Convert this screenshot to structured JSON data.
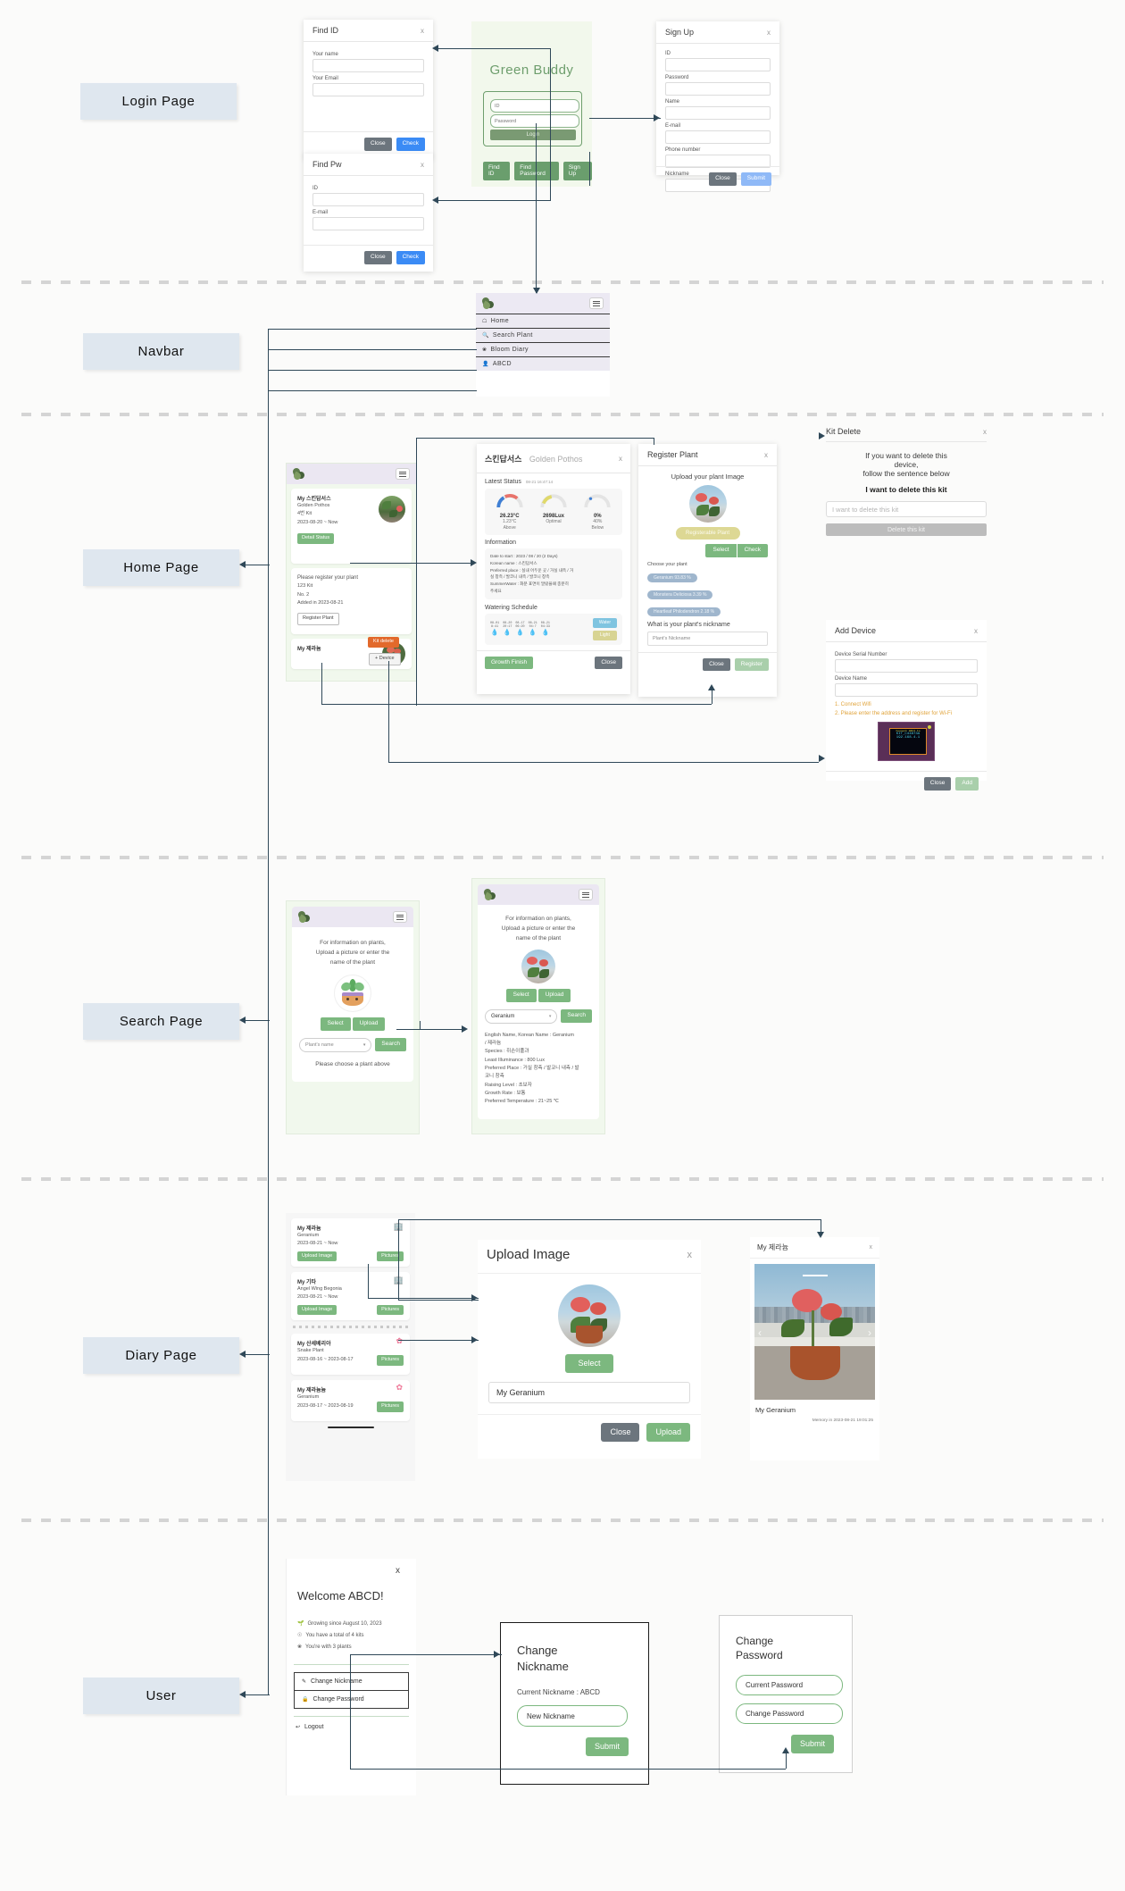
{
  "sections": [
    {
      "label": "Login Page"
    },
    {
      "label": "Navbar"
    },
    {
      "label": "Home Page"
    },
    {
      "label": "Search Page"
    },
    {
      "label": "Diary Page"
    },
    {
      "label": "User"
    }
  ],
  "login": {
    "app_title": "Green Buddy",
    "id_placeholder": "ID",
    "password_placeholder": "Password",
    "login_button": "Login",
    "find_id_button": "Find ID",
    "find_password_button": "Find Password",
    "sign_up_button": "Sign Up",
    "find_id_modal": {
      "title": "Find ID",
      "close_icon": "x",
      "fields": [
        {
          "label": "Your name",
          "value": ""
        },
        {
          "label": "Your Email",
          "value": ""
        }
      ],
      "close_button": "Close",
      "check_button": "Check"
    },
    "find_pw_modal": {
      "title": "Find Pw",
      "close_icon": "x",
      "fields": [
        {
          "label": "ID",
          "value": ""
        },
        {
          "label": "E-mail",
          "value": ""
        }
      ],
      "close_button": "Close",
      "check_button": "Check"
    },
    "sign_up_modal": {
      "title": "Sign Up",
      "close_icon": "x",
      "fields": [
        {
          "label": "ID",
          "value": ""
        },
        {
          "label": "Password",
          "value": ""
        },
        {
          "label": "Name",
          "value": ""
        },
        {
          "label": "E-mail",
          "value": ""
        },
        {
          "label": "Phone number",
          "value": ""
        },
        {
          "label": "Nickname",
          "value": ""
        }
      ],
      "close_button": "Close",
      "submit_button": "Submit"
    }
  },
  "navbar": {
    "items": [
      {
        "label": "Home",
        "icon": "home-icon"
      },
      {
        "label": "Search Plant",
        "icon": "search-icon"
      },
      {
        "label": "Bloom Diary",
        "icon": "flower-icon"
      },
      {
        "label": "ABCD",
        "icon": "user-icon"
      }
    ]
  },
  "home": {
    "phone": {
      "kit_card_1": {
        "nickname": "My 스킨답서스",
        "species": "Golden Pothos",
        "kit_name": "4번 Kit",
        "period": "2023-08-20 ~ Now",
        "detail_button": "Detail Status"
      },
      "kit_card_2": {
        "prompt": "Please register your plant",
        "kit_name": "123 Kit",
        "number": "No. 2",
        "added": "Added in 2023-08-21",
        "register_button": "Register Plant",
        "kit_delete_button": "Kit delete",
        "add_device_button": "+ Device"
      },
      "kit_card_3": {
        "nickname": "My 제라늄"
      }
    },
    "status_modal": {
      "title": "스킨답서스",
      "subtitle": "Golden Pothos",
      "close_icon": "x",
      "latest_status_label": "Latest Status",
      "latest_status_time": "08-21 16:47:14",
      "gauges": [
        {
          "value": "26.23°C",
          "line1": "1.23°C",
          "line2": "Above",
          "color": "#4a84d8"
        },
        {
          "value": "2698Lux",
          "line1": "Optimal",
          "line2": "",
          "color": "#e0d96a"
        },
        {
          "value": "0%",
          "line1": "40%",
          "line2": "Below",
          "color": "#4a84d8"
        }
      ],
      "information_label": "Information",
      "information_rows": [
        "Date to start : 2023 / 08 / 20 (2 Days)",
        "Korean name : 스킨답서스",
        "Preferred place : 실내 어두운 곳 / 거실 내측 / 거",
        "실 창측 / 발코니 내측 / 발코니 창측",
        "SummerWater : 화분 표면이 말랐을때 충분히",
        "주세요"
      ],
      "watering_label": "Watering Schedule",
      "watering_dates": [
        "08-01\n8:41",
        "08-20\n20:17",
        "08-17\n06:20",
        "08-21\n04:7",
        "08-21\n04:33"
      ],
      "water_button": "Water",
      "light_button": "Light",
      "growth_finish_button": "Growth Finish",
      "close_button": "Close"
    },
    "register_modal": {
      "title": "Register Plant",
      "close_icon": "x",
      "upload_label": "Upload your plant Image",
      "registerable_badge": "Registerable Plant",
      "select_button": "Select",
      "check_button": "Check",
      "choose_label": "Choose your plant",
      "candidates": [
        "Geranium   93.83 %",
        "Monstera Deliciosa   3.39 %",
        "Heartleaf Philodendron   2.18 %"
      ],
      "nickname_question": "What is your plant's nickname",
      "nickname_placeholder": "Plant's Nickname",
      "close_button": "Close",
      "register_button": "Register"
    },
    "kit_delete_modal": {
      "title": "Kit Delete",
      "close_icon": "x",
      "line1": "If you want to delete this",
      "line2": "device,",
      "line3": "follow the sentence below",
      "confirm_sentence": "I want to delete this kit",
      "input_placeholder": "I want to delete this kit",
      "delete_button": "Delete this kit"
    },
    "add_device_modal": {
      "title": "Add Device",
      "close_icon": "x",
      "fields": [
        {
          "label": "Device Serial Number",
          "value": ""
        },
        {
          "label": "Device Name",
          "value": ""
        }
      ],
      "step1": "1. Connect Wifi",
      "step2": "2. Please enter the address and register for Wi-Fi",
      "device_screen_lines": [
        "Connect WIFI to",
        "KIT_C44873A",
        "192.168.4.1"
      ],
      "close_button": "Close",
      "add_button": "Add"
    }
  },
  "search": {
    "phone1": {
      "prompt_line1": "For information on plants,",
      "prompt_line2": "Upload a picture or enter the",
      "prompt_line3": "name of the plant",
      "select_button": "Select",
      "upload_button": "Upload",
      "select_placeholder": "Plant's name",
      "search_button": "Search",
      "hint": "Please choose a plant above"
    },
    "phone2": {
      "prompt_line1": "For information on plants,",
      "prompt_line2": "Upload a picture or enter the",
      "prompt_line3": "name of the plant",
      "select_button": "Select",
      "upload_button": "Upload",
      "selected_plant": "Geranium",
      "search_button": "Search",
      "details": [
        "English Name, Korean Name : Geranium",
        "/ 제라늄",
        "Species : 쥐손이풀과",
        "Least Illuminance : 800 Lux",
        "Preferred Place : 거실 창측 / 발코니 내측 / 발",
        "코니 창측",
        "Raising Level : 초보자",
        "Growth Rate : 보통",
        "Preferred Temperature : 21~25 ℃"
      ]
    }
  },
  "diary": {
    "list": [
      {
        "nickname": "My 제라늄",
        "species": "Geranium",
        "period": "2023-08-21 ~ Now",
        "upload_button": "Upload Image",
        "pictures_button": "Pictures",
        "icon": "watering-can-icon"
      },
      {
        "nickname": "My 기타",
        "species": "Angel Wing Begonia",
        "period": "2023-08-21 ~ Now",
        "upload_button": "Upload Image",
        "pictures_button": "Pictures",
        "icon": "watering-can-icon"
      },
      {
        "nickname": "My 산세베리아",
        "species": "Snake Plant",
        "period": "2023-08-16 ~ 2023-08-17",
        "pictures_button": "Pictures",
        "icon": "flower-icon"
      },
      {
        "nickname": "My 제라늄늄",
        "species": "Geranium",
        "period": "2023-08-17 ~ 2023-08-19",
        "pictures_button": "Pictures",
        "icon": "flower-icon"
      }
    ],
    "upload_modal": {
      "title": "Upload Image",
      "close_icon": "x",
      "select_button": "Select",
      "name_value": "My Geranium",
      "close_button": "Close",
      "upload_button": "Upload"
    },
    "viewer_modal": {
      "title": "My 제라늄",
      "close_icon": "x",
      "caption": "My Geranium",
      "memory": "Memory in 2023-08-21 19:01:25",
      "prev_icon": "chevron-left-icon",
      "next_icon": "chevron-right-icon"
    }
  },
  "user": {
    "close_icon": "x",
    "welcome": "Welcome ABCD!",
    "stats": [
      {
        "icon": "sprout-icon",
        "text": "Growing since August 10, 2023"
      },
      {
        "icon": "kit-icon",
        "text": "You have a total of 4 kits"
      },
      {
        "icon": "plant-icon",
        "text": "You're with 3 plants"
      }
    ],
    "menu": [
      {
        "icon": "pencil-icon",
        "label": "Change Nickname"
      },
      {
        "icon": "lock-icon",
        "label": "Change Password"
      }
    ],
    "logout": {
      "icon": "logout-icon",
      "label": "Logout"
    },
    "nickname_modal": {
      "title_line1": "Change",
      "title_line2": "Nickname",
      "current": "Current Nickname : ABCD",
      "input_placeholder": "New Nickname",
      "submit_button": "Submit"
    },
    "password_modal": {
      "title_line1": "Change",
      "title_line2": "Password",
      "current_placeholder": "Current Password",
      "new_placeholder": "Change Password",
      "submit_button": "Submit"
    }
  },
  "colors": {
    "accent_green": "#7cb87f",
    "dark_green": "#6a9e6d",
    "label_bg": "#dfe7ef",
    "line": "#2f4858",
    "orange": "#e2692b",
    "blue": "#3b8bf5"
  }
}
